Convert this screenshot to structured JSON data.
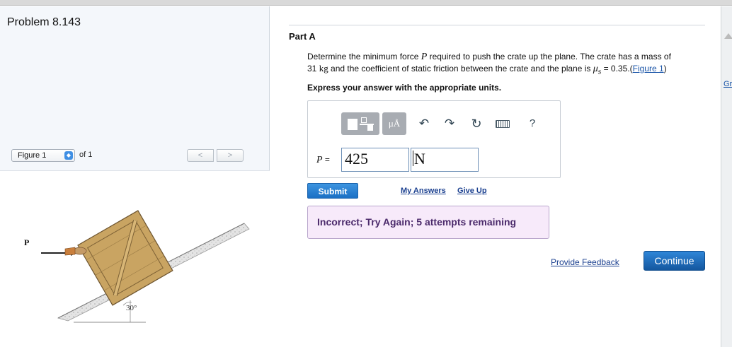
{
  "problem": {
    "title": "Problem 8.143"
  },
  "figure_nav": {
    "select_value": "Figure 1",
    "of_label": "of 1",
    "prev_symbol": "<",
    "next_symbol": ">"
  },
  "figure": {
    "force_label": "P",
    "angle_label": "30°"
  },
  "part": {
    "label": "Part A",
    "question": {
      "prefix": "Determine the minimum force ",
      "symbol_p": "P",
      "mid1": " required to push the crate up the plane. The crate has a mass of",
      "mass_value": "31",
      "mass_unit": "kg",
      "mid2": " and the coefficient of static friction between the crate and the plane is ",
      "mu_symbol": "μ",
      "mu_sub": "s",
      "mu_value": " = 0.35.(",
      "figure_link": "Figure 1",
      "suffix": ")"
    },
    "instructions": "Express your answer with the appropriate units."
  },
  "toolbar": {
    "templates_icon": "templates-icon",
    "mu_label": "μÅ",
    "undo_icon": "↶",
    "redo_icon": "↷",
    "reset_icon": "↻",
    "keyboard_icon": "keyboard-icon",
    "help_label": "?"
  },
  "answer": {
    "variable": "P",
    "equals": " = ",
    "value": "425",
    "unit": "N"
  },
  "actions": {
    "submit_label": "Submit",
    "my_answers_label": "My Answers",
    "give_up_label": "Give Up"
  },
  "feedback": {
    "message": "Incorrect; Try Again; 5 attempts remaining"
  },
  "footer": {
    "provide_feedback_label": "Provide Feedback",
    "continue_label": "Continue"
  },
  "edge": {
    "partial_label": "Gra"
  },
  "colors": {
    "accent_blue": "#1b6fc4",
    "feedback_bg": "#f7eafa",
    "feedback_text": "#4b2a6b",
    "crate_wood": "#c9a462",
    "link_blue": "#1a3f8f"
  }
}
